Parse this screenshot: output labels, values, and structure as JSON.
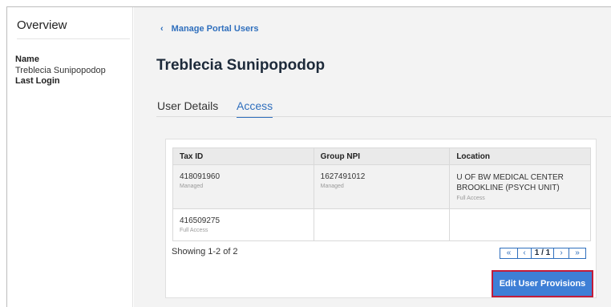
{
  "sidebar": {
    "overview": "Overview",
    "name_label": "Name",
    "name_value": "Treblecia Sunipopodop",
    "last_login_label": "Last Login"
  },
  "header": {
    "back_chevron": "‹",
    "back_label": "Manage Portal Users",
    "title": "Treblecia Sunipopodop"
  },
  "tabs": [
    {
      "label": "User Details",
      "active": false
    },
    {
      "label": "Access",
      "active": true
    }
  ],
  "table": {
    "columns": [
      "Tax ID",
      "Group NPI",
      "Location"
    ],
    "rows": [
      {
        "tax_id": "418091960",
        "tax_sub": "Managed",
        "npi": "1627491012",
        "npi_sub": "Managed",
        "location_line1": "U OF BW MEDICAL CENTER",
        "location_line2": "BROOKLINE (PSYCH UNIT)",
        "location_sub": "Full Access"
      },
      {
        "tax_id": "416509275",
        "tax_sub": "Full Access",
        "npi": "",
        "npi_sub": "",
        "location_line1": "",
        "location_line2": "",
        "location_sub": ""
      }
    ]
  },
  "pagination": {
    "showing": "Showing 1-2 of 2",
    "first": "«",
    "prev": "‹",
    "current": "1 / 1",
    "next": "›",
    "last": "»"
  },
  "actions": {
    "edit_label": "Edit User Provisions"
  },
  "colors": {
    "accent": "#2f6fbd",
    "button": "#3e7fd6",
    "button_border": "#c21c3a",
    "panel_bg": "#f3f3f3"
  }
}
